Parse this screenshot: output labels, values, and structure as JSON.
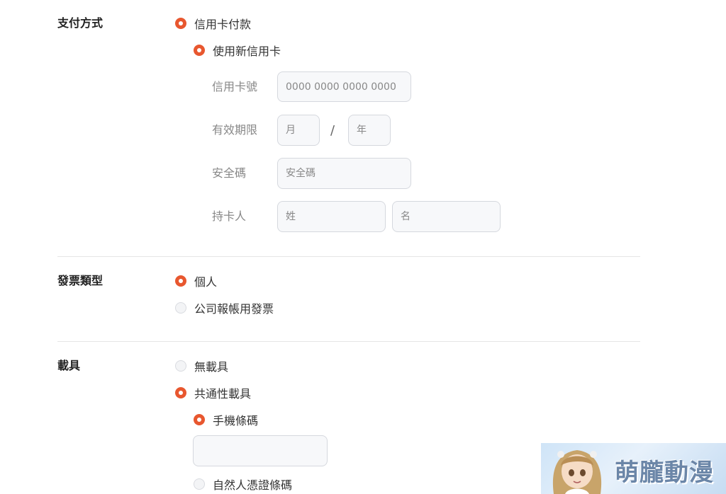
{
  "payment": {
    "label": "支付方式",
    "credit_card_option": "信用卡付款",
    "new_card_option": "使用新信用卡",
    "card_number_label": "信用卡號",
    "card_number_placeholder": "0000 0000 0000 0000",
    "expiry_label": "有效期限",
    "expiry_month_placeholder": "月",
    "expiry_separator": "/",
    "expiry_year_placeholder": "年",
    "security_code_label": "安全碼",
    "security_code_placeholder": "安全碼",
    "cardholder_label": "持卡人",
    "last_name_placeholder": "姓",
    "first_name_placeholder": "名"
  },
  "invoice": {
    "label": "發票類型",
    "options": [
      {
        "label": "個人",
        "selected": true
      },
      {
        "label": "公司報帳用發票",
        "selected": false
      }
    ]
  },
  "carrier": {
    "label": "載具",
    "options": [
      {
        "label": "無載具",
        "selected": false
      },
      {
        "label": "共通性載具",
        "selected": true
      }
    ],
    "sub_options": [
      {
        "label": "手機條碼",
        "selected": true
      },
      {
        "label": "自然人憑證條碼",
        "selected": false
      }
    ],
    "mobile_barcode_value": ""
  },
  "watermark": {
    "text": "萌朧動漫"
  },
  "colors": {
    "accent": "#e8572f",
    "input_bg": "#f7f8fa",
    "input_border": "#d5d8de",
    "divider": "#e6e6e6"
  }
}
